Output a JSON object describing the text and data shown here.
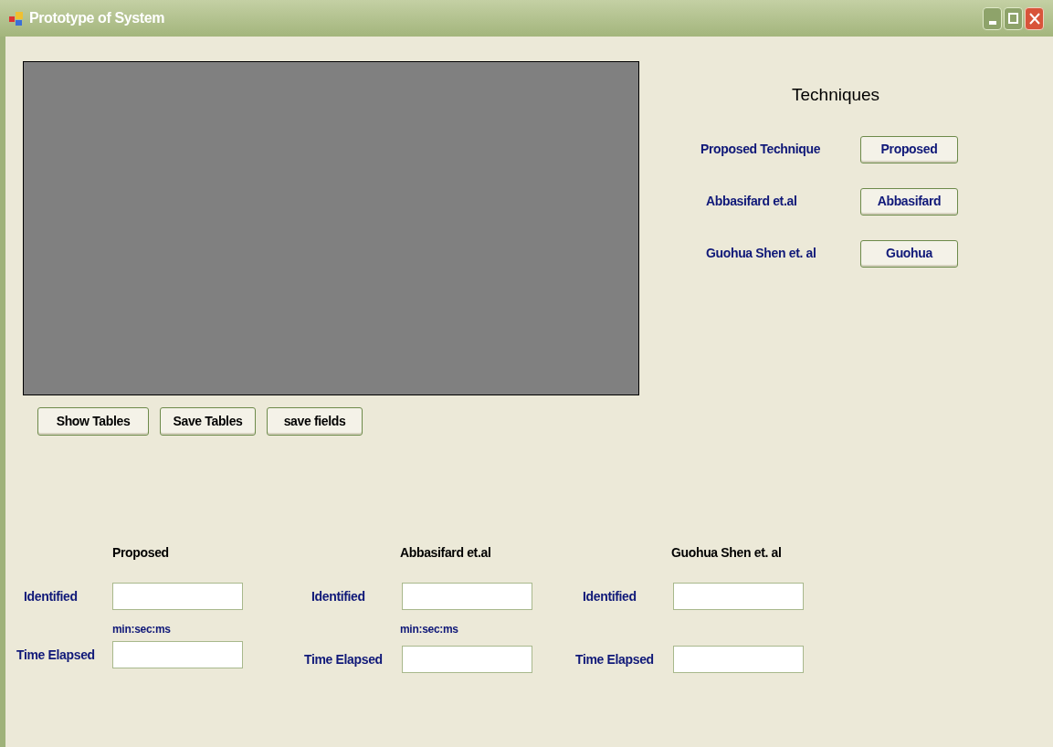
{
  "window": {
    "title": "Prototype of System"
  },
  "techniques": {
    "title": "Techniques",
    "items": [
      {
        "label": "Proposed Technique",
        "button": "Proposed"
      },
      {
        "label": "Abbasifard et.al",
        "button": "Abbasifard"
      },
      {
        "label": "Guohua Shen et. al",
        "button": "Guohua"
      }
    ]
  },
  "table_buttons": [
    "Show Tables",
    "Save Tables",
    "save fields"
  ],
  "results": [
    {
      "heading": "Proposed",
      "identified_label": "Identified",
      "time_hint": "min:sec:ms",
      "time_label": "Time Elapsed"
    },
    {
      "heading": "Abbasifard et.al",
      "identified_label": "Identified",
      "time_hint": "min:sec:ms",
      "time_label": "Time Elapsed"
    },
    {
      "heading": "Guohua Shen et. al",
      "identified_label": "Identified",
      "time_label": "Time Elapsed"
    }
  ]
}
